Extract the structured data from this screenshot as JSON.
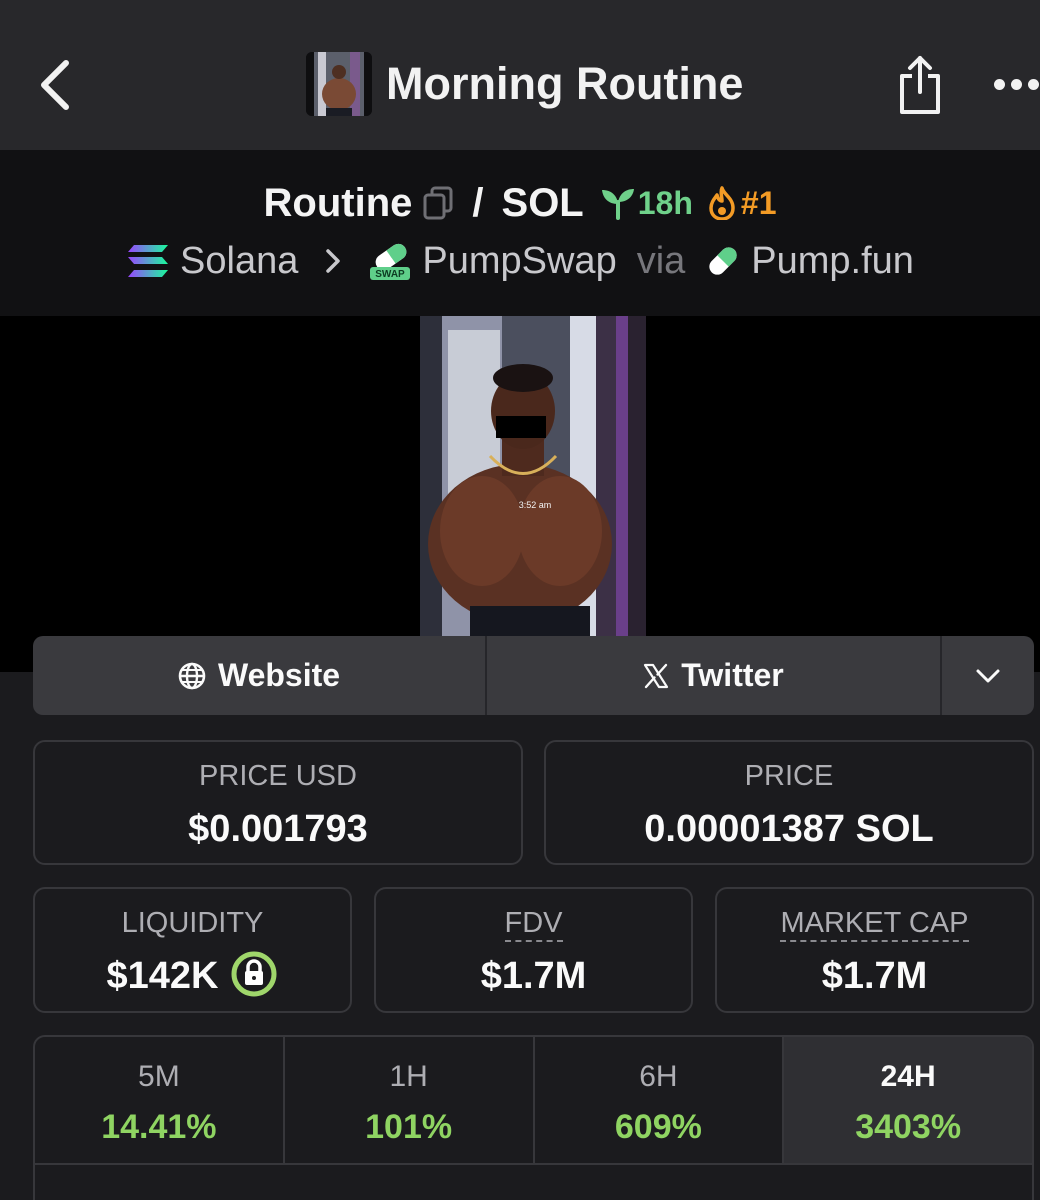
{
  "header": {
    "title": "Morning Routine"
  },
  "pair": {
    "base": "Routine",
    "separator": "/",
    "quote": "SOL",
    "age": "18h",
    "rank": "#1"
  },
  "route": {
    "chain": "Solana",
    "dex": "PumpSwap",
    "dex_badge": "SWAP",
    "via": "via",
    "launchpad": "Pump.fun"
  },
  "media": {
    "overlay_text": "3:52 am"
  },
  "links": {
    "website": "Website",
    "twitter": "Twitter"
  },
  "stats": {
    "price_usd": {
      "label": "PRICE USD",
      "value": "$0.001793"
    },
    "price": {
      "label": "PRICE",
      "value": "0.00001387 SOL"
    },
    "liquidity": {
      "label": "LIQUIDITY",
      "value": "$142K"
    },
    "fdv": {
      "label": "FDV",
      "value": "$1.7M"
    },
    "market_cap": {
      "label": "MARKET CAP",
      "value": "$1.7M"
    }
  },
  "changes": [
    {
      "period": "5M",
      "value": "14.41%"
    },
    {
      "period": "1H",
      "value": "101%"
    },
    {
      "period": "6H",
      "value": "609%"
    },
    {
      "period": "24H",
      "value": "3403%"
    }
  ],
  "colors": {
    "positive": "#8fd462",
    "age": "#6fd18a",
    "rank": "#f39b25",
    "lock": "#9fd66b"
  },
  "icons": {
    "back": "chevron-left-icon",
    "share": "share-icon",
    "more": "more-horizontal-icon",
    "copy": "copy-icon",
    "age": "seedling-icon",
    "rank": "fire-icon",
    "chain": "solana-icon",
    "dex": "pumpswap-icon",
    "launchpad": "pill-icon",
    "website": "globe-icon",
    "twitter": "x-logo-icon",
    "expand": "chevron-down-icon",
    "liquidity_lock": "lock-icon"
  }
}
